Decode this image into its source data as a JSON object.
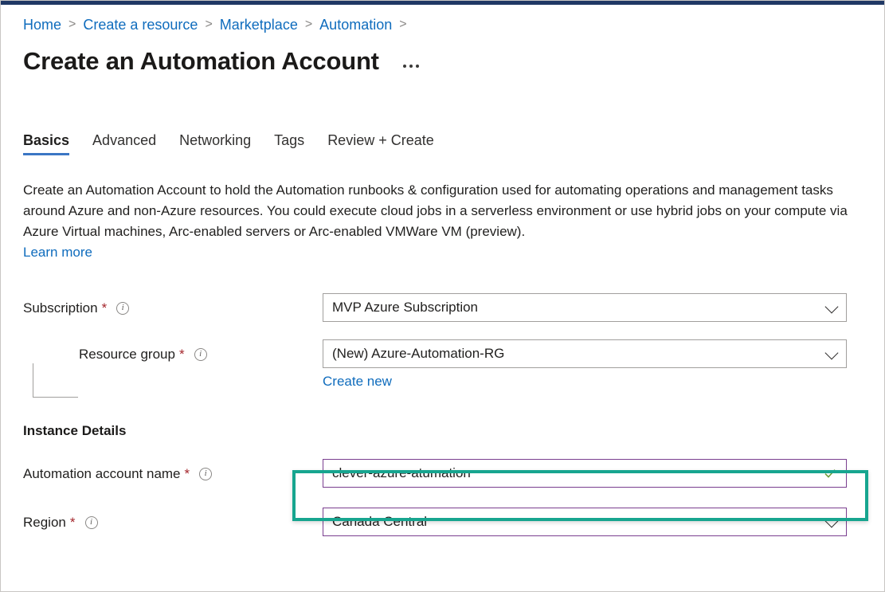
{
  "breadcrumb": {
    "separator": ">",
    "items": [
      {
        "label": "Home"
      },
      {
        "label": "Create a resource"
      },
      {
        "label": "Marketplace"
      },
      {
        "label": "Automation"
      }
    ]
  },
  "header": {
    "title": "Create an Automation Account",
    "more_menu": "…"
  },
  "tabs": [
    {
      "label": "Basics",
      "active": true
    },
    {
      "label": "Advanced",
      "active": false
    },
    {
      "label": "Networking",
      "active": false
    },
    {
      "label": "Tags",
      "active": false
    },
    {
      "label": "Review + Create",
      "active": false
    }
  ],
  "description": {
    "text": "Create an Automation Account to hold the Automation runbooks & configuration used for automating operations and management tasks around Azure and non-Azure resources. You could execute cloud jobs in a serverless environment or use hybrid jobs on your compute via Azure Virtual machines, Arc-enabled servers or Arc-enabled VMWare VM (preview).",
    "learn_more": "Learn more"
  },
  "form": {
    "required_marker": "*",
    "info_glyph": "i",
    "subscription": {
      "label": "Subscription",
      "value": "MVP Azure Subscription"
    },
    "resource_group": {
      "label": "Resource group",
      "value": "(New) Azure-Automation-RG",
      "create_new": "Create new"
    },
    "instance_details_heading": "Instance Details",
    "automation_account_name": {
      "label": "Automation account name",
      "value": "clever-azure-atumation",
      "validation": "valid"
    },
    "region": {
      "label": "Region",
      "value": "Canada Central"
    }
  },
  "colors": {
    "link_blue": "#0f6cbd",
    "tab_accent": "#3b76c4",
    "required_red": "#a4262c",
    "input_accent": "#7a3e8f",
    "highlight_teal": "#17a58f",
    "valid_green": "#6f9d3a",
    "top_strip": "#1f3864"
  }
}
